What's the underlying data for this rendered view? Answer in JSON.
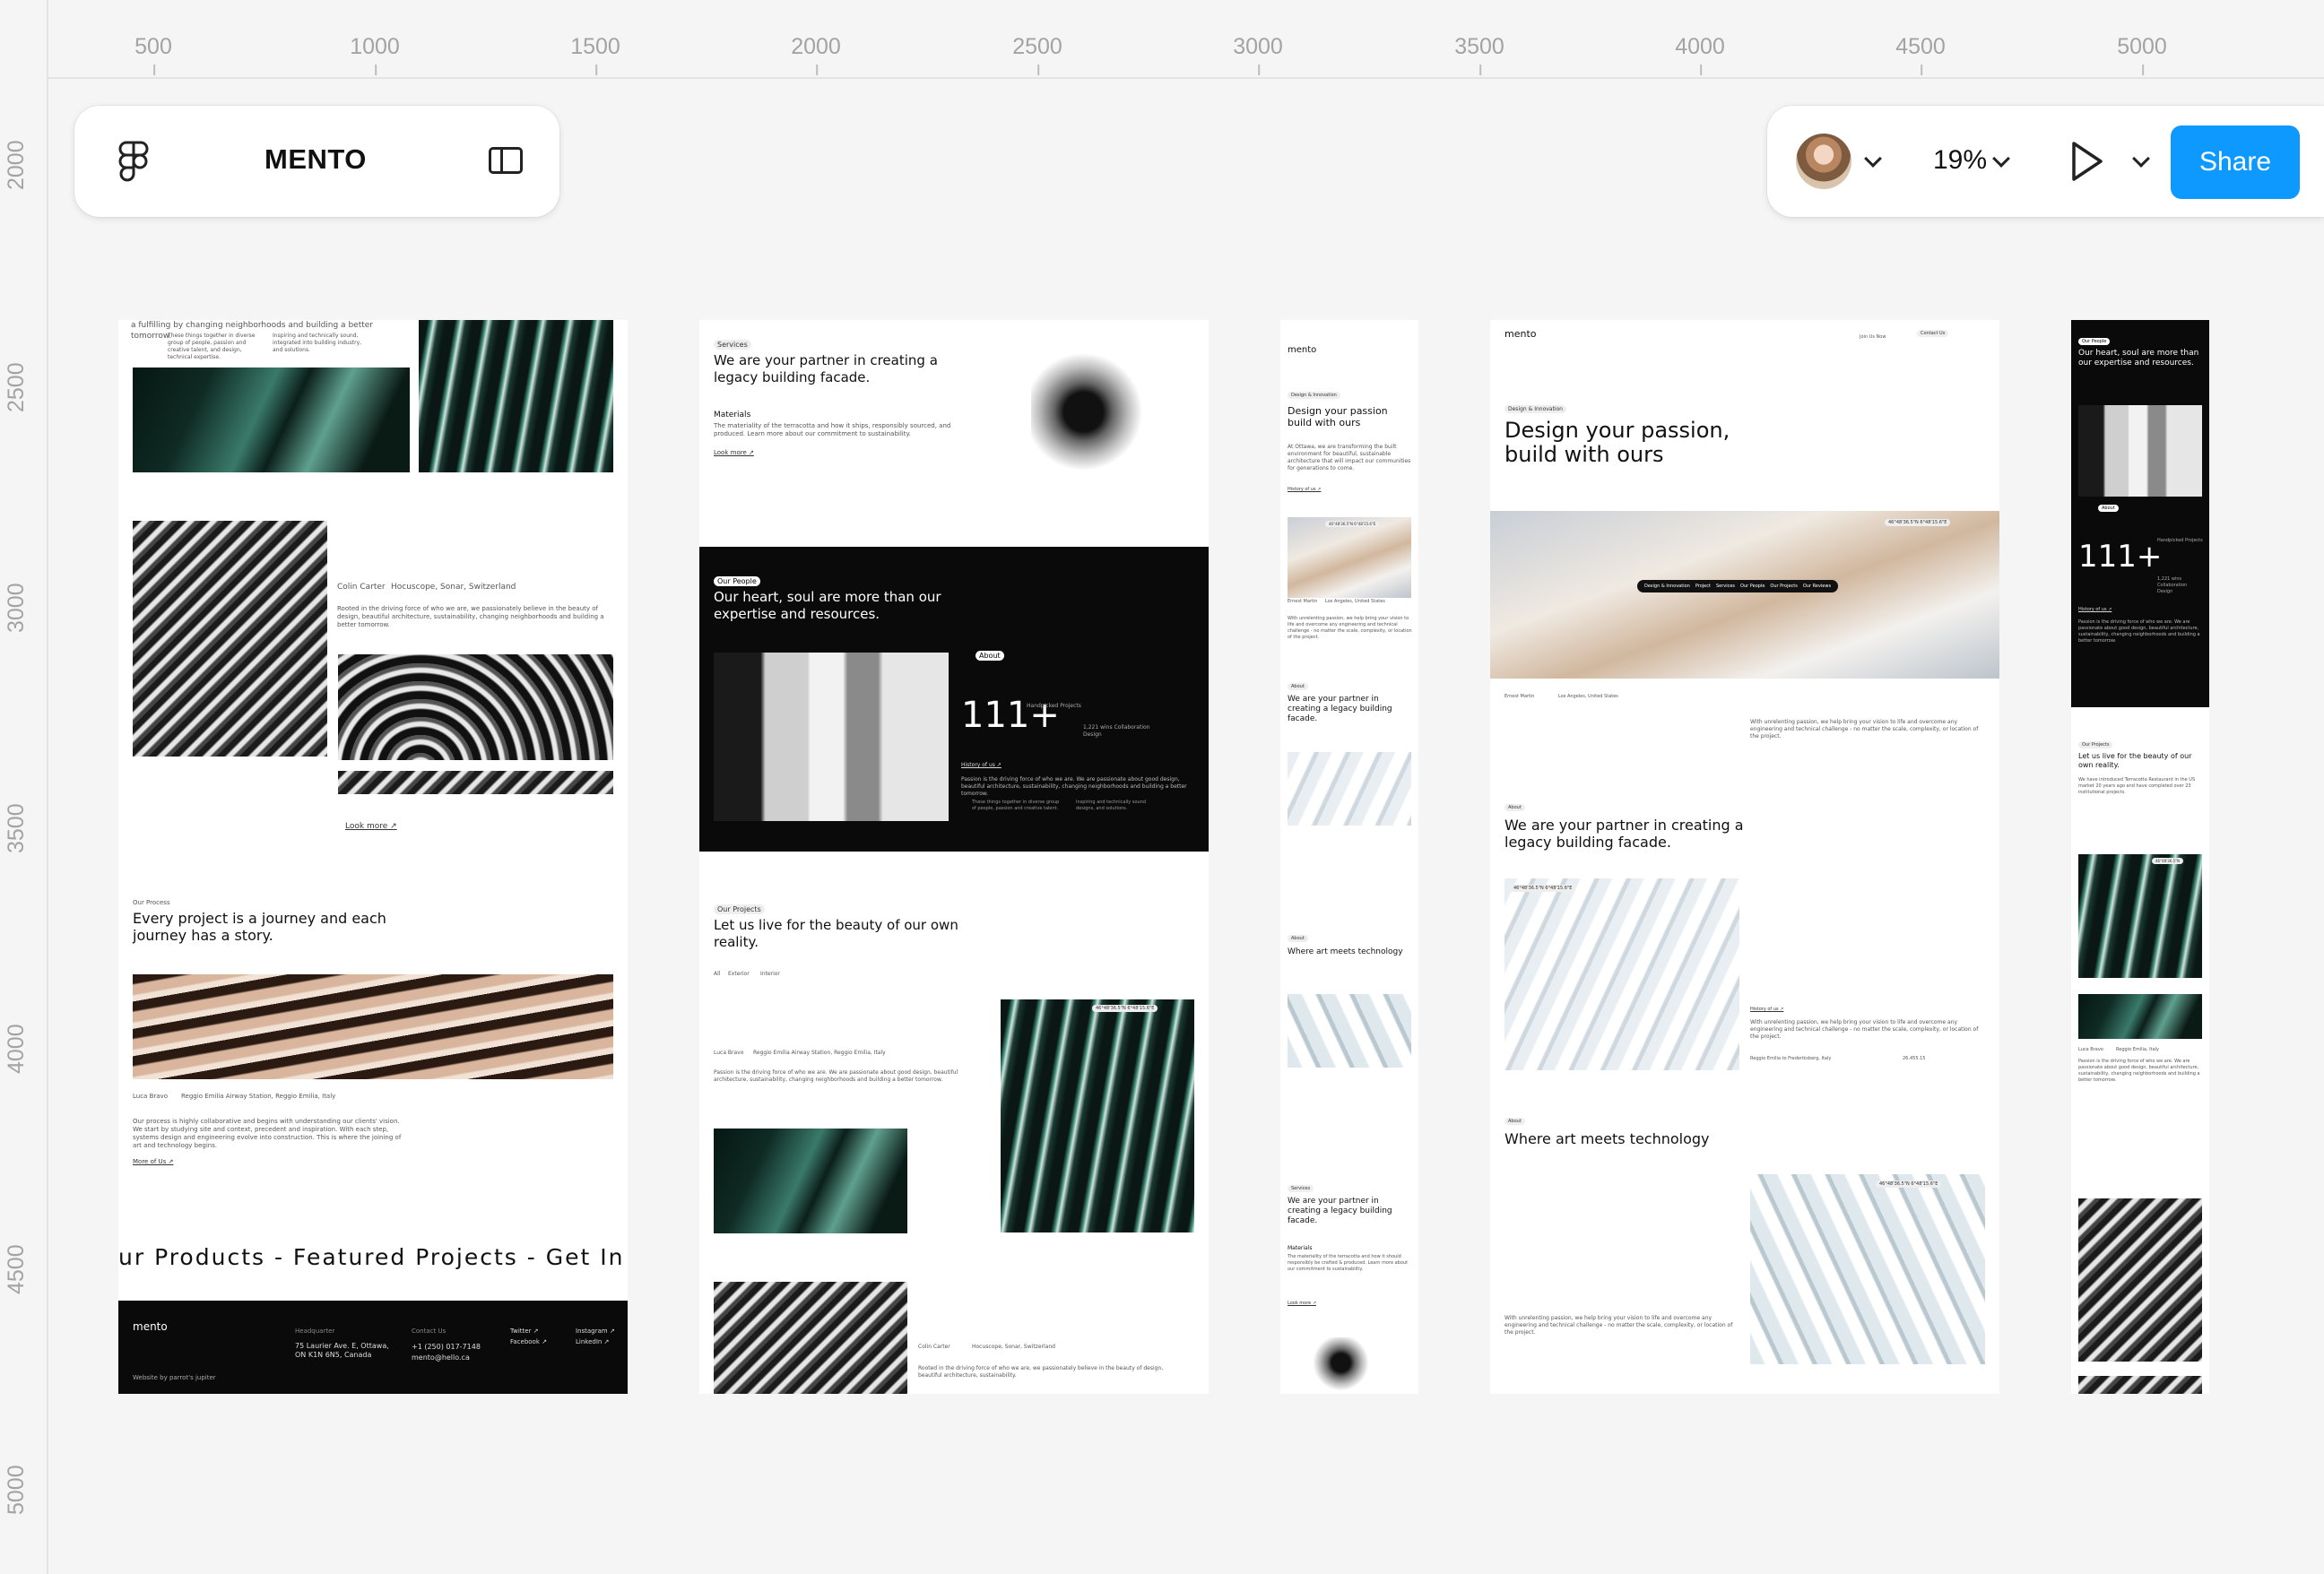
{
  "ruler": {
    "x_ticks": [
      "500",
      "1000",
      "1500",
      "2000",
      "2500",
      "3000",
      "3500",
      "4000",
      "4500",
      "5000"
    ],
    "y_ticks": [
      "2000",
      "2500",
      "3000",
      "3500",
      "4000",
      "4500",
      "5000"
    ]
  },
  "toolbar_left": {
    "app_icon": "figma-logo-icon",
    "file_title": "MENTO",
    "sidebar_icon": "sidebar-toggle-icon"
  },
  "toolbar_right": {
    "zoom": "19%",
    "share_label": "Share",
    "colors": {
      "share": "#0d99ff"
    }
  },
  "frame1": {
    "top_line": "a fulfilling by changing neighborhoods and building a better tomorrow.",
    "caption_a": "These things together in diverse group of people, passion and creative talent, and design, technical expertise.",
    "caption_b": "Inspiring and technically sound, integrated into building industry, and solutions.",
    "location_row": [
      "Colin Carter",
      "Hocuscope, Sonar, Switzerland"
    ],
    "paragraph": "Rooted in the driving force of who we are, we passionately believe in the beauty of design, beautiful architecture, sustainability, changing neighborhoods and building a better tomorrow.",
    "look_more": "Look more ↗",
    "section_tag": "Our Process",
    "section_title": "Every project is a journey and each journey has a story.",
    "credit_row": [
      "Luca Bravo",
      "Reggio Emilia Airway Station, Reggio Emilia, Italy"
    ],
    "process_text": "Our process is highly collaborative and begins with understanding our clients' vision. We start by studying site and context, precedent and inspiration. With each step, systems design and engineering evolve into construction. This is where the joining of art and technology begins.",
    "more_link": "More of Us ↗",
    "marquee": "ur Products - Featured Projects - Get In",
    "footer": {
      "logo": "mento",
      "hq_label": "Headquarter",
      "hq_address": "75 Laurier Ave. E, Ottawa, ON K1N 6N5, Canada",
      "contact_label": "Contact Us",
      "phone": "+1 (250) 017-7148",
      "email": "mento@hello.ca",
      "social": [
        "Twitter ↗",
        "Facebook ↗",
        "Instagram ↗",
        "LinkedIn ↗"
      ],
      "credit": "Website by parrot's jupiter"
    }
  },
  "frame2": {
    "tag": "Services",
    "title": "We are your partner in creating a legacy building facade.",
    "sub_title": "Materials",
    "sub_text": "The materiality of the terracotta and how it ships, responsibly sourced, and produced. Learn more about our commitment to sustainability.",
    "look_more": "Look more ↗",
    "dark_tag": "Our People",
    "dark_title": "Our heart, soul are more than our expertise and resources.",
    "dark_pill": "About",
    "stat": "111+",
    "stat_caption": "Handpicked Projects",
    "stat_sub": "1,221 wins Collaboration Design",
    "history": "History of us ↗",
    "dark_text": "Passion is the driving force of who we are. We are passionate about good design, beautiful architecture, sustainability, changing neighborhoods and building a better tomorrow.",
    "dark_caption_a": "These things together in diverse group of people, passion and creative talent.",
    "dark_caption_b": "Inspiring and technically sound designs, and solutions.",
    "projects_tag": "Our Projects",
    "projects_title": "Let us live for the beauty of our own reality.",
    "filters": [
      "All",
      "Exterior",
      "Interior"
    ],
    "credit_row": [
      "Luca Bravo",
      "Reggio Emilia Airway Station, Reggio Emilia, Italy"
    ],
    "projects_text": "Passion is the driving force of who we are. We are passionate about good design, beautiful architecture, sustainability, changing neighborhoods and building a better tomorrow.",
    "coord_label": "46°48'36.5\"N 6°48'15.6\"E",
    "bottom_row": [
      "Colin Carter",
      "Hocuscope, Sonar, Switzerland"
    ],
    "bottom_text": "Rooted in the driving force of who we are, we passionately believe in the beauty of design, beautiful architecture, sustainability."
  },
  "frame3": {
    "logo": "mento",
    "tag": "Design & Innovation",
    "title": "Design your passion build with ours",
    "intro": "At Ottawa, we are transforming the built environment for beautiful, sustainable architecture that will impact our communities for generations to come.",
    "history": "History of us ↗",
    "coord": "46°48'36.5\"N 6°48'15.6\"E",
    "credit": [
      "Ernest Martin",
      "Los Angeles, United States"
    ],
    "card_text": "With unrelenting passion, we help bring your vision to life and overcome any engineering and technical challenge - no matter the scale, complexity, or location of the project.",
    "about_tag": "About",
    "about_title": "We are your partner in creating a legacy building facade.",
    "art_tag": "About",
    "art_title": "Where art meets technology",
    "services_tag": "Services",
    "services_title": "We are your partner in creating a legacy building facade.",
    "materials": "Materials",
    "materials_text": "The materiality of the terracotta and how it should responsibly be crafted & produced. Learn more about our commitment to sustainability.",
    "look_more": "Look more ↗"
  },
  "frame4": {
    "logo": "mento",
    "nav_link": "Join Us Now",
    "nav_pill": "Contact Us",
    "tag": "Design & Innovation",
    "title": "Design your passion, build with ours",
    "coord": "46°48'36.5\"N 6°48'15.6\"E",
    "pills": [
      "Design & Innovation",
      "Project",
      "Services",
      "Our People",
      "Our Projects",
      "Our Reviews"
    ],
    "credit": [
      "Ernest Martin",
      "Los Angeles, United States"
    ],
    "hero_text": "With unrelenting passion, we help bring your vision to life and overcome any engineering and technical challenge - no matter the scale, complexity, or location of the project.",
    "about_tag": "About",
    "about_title": "We are your partner in creating a legacy building facade.",
    "coord_b": "46°48'36.5\"N 6°48'15.6\"E",
    "history": "History of us ↗",
    "about_text": "With unrelenting passion, we help bring your vision to life and overcome any engineering and technical challenge - no matter the scale, complexity, or location of the project.",
    "addr_row": [
      "Reggio Emilia to Frederiksberg, Italy",
      "26.455.15"
    ],
    "art_tag": "About",
    "art_title": "Where art meets technology",
    "coord_c": "46°48'36.5\"N 6°48'15.6\"E",
    "art_text": "With unrelenting passion, we help bring your vision to life and overcome any engineering and technical challenge - no matter the scale, complexity, or location of the project."
  },
  "frame5": {
    "tag": "Our People",
    "title": "Our heart, soul are more than our expertise and resources.",
    "pill": "About",
    "stat": "111+",
    "stat_caption": "Handpicked Projects",
    "stat_sub": "1,221 wins Collaboration Design",
    "history": "History of us ↗",
    "dark_text": "Passion is the driving force of who we are. We are passionate about good design, beautiful architecture, sustainability, changing neighborhoods and building a better tomorrow.",
    "projects_tag": "Our Projects",
    "projects_title": "Let us live for the beauty of our own reality.",
    "projects_text": "We have introduced Terracotta Restaurant in the US market 20 years ago and have completed over 23 institutional projects.",
    "coord": "46°48'36.5\"N",
    "credit": [
      "Luca Bravo",
      "Reggio Emilia, Italy"
    ],
    "text_b": "Passion is the driving force of who we are. We are passionate about good design, beautiful architecture, sustainability, changing neighborhoods and building a better tomorrow."
  }
}
